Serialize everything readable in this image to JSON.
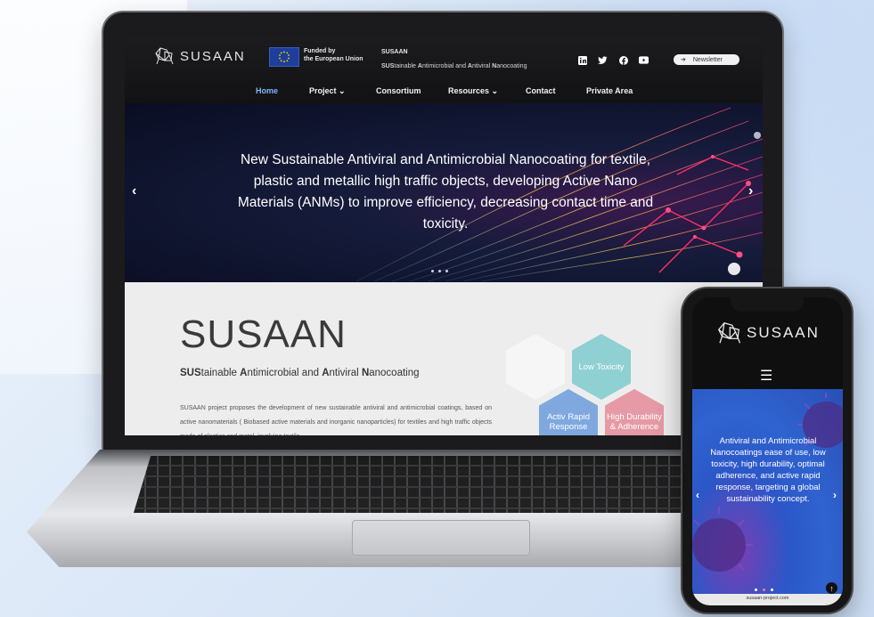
{
  "site": {
    "logo_text": "SUSAAN",
    "eu": {
      "line1": "Funded by",
      "line2": "the European Union"
    },
    "project_short": "SUSAAN",
    "project_full_prefix": "SUS",
    "project_full_rest": "tainable ",
    "project_full_a": "A",
    "project_full_mid": "ntimicrobial and ",
    "project_full_a2": "A",
    "project_full_mid2": "ntiviral ",
    "project_full_n": "N",
    "project_full_end": "anocoating",
    "social_icons": [
      "linkedin-icon",
      "twitter-icon",
      "facebook-icon",
      "youtube-icon"
    ],
    "newsletter_label": "Newsletter",
    "nav": [
      {
        "label": "Home",
        "active": true
      },
      {
        "label": "Project ⌄"
      },
      {
        "label": "Consortium"
      },
      {
        "label": "Resources ⌄"
      },
      {
        "label": "Contact"
      },
      {
        "label": "Private Area"
      }
    ]
  },
  "hero": {
    "text": "New Sustainable Antiviral and Antimicrobial Nanocoating for textile, plastic and metallic high traffic objects, developing Active Nano Materials (ANMs) to improve efficiency, decreasing contact time and toxicity.",
    "prev": "‹",
    "next": "›"
  },
  "intro": {
    "title": "SUSAAN",
    "sub_sus": "SUS",
    "sub_1": "tainable ",
    "sub_a": "A",
    "sub_2": "ntimicrobial and ",
    "sub_a2": "A",
    "sub_3": "ntiviral ",
    "sub_n": "N",
    "sub_4": "anocoating",
    "body": "SUSAAN project proposes the development of new sustainable antiviral and antimicrobial coatings, based on active nanomaterials ( Biobased active materials and inorganic nanoparticles) for textiles and high traffic objects made of plastics and metal, involving textile,"
  },
  "hexagons": [
    {
      "label": "",
      "color": "#f4f4f4"
    },
    {
      "label": "Low Toxicity",
      "color": "#8fd0d2"
    },
    {
      "label": "Activ Rapid Response",
      "color": "#7fa8df"
    },
    {
      "label": "High Durability & Adherence",
      "color": "#e59aa5"
    }
  ],
  "phone": {
    "logo_text": "SUSAAN",
    "menu_icon": "☰",
    "hero_text": "Antiviral and Antimicrobial Nanocoatings ease of use, low toxicity, high durability, optimal adherence, and active rapid response, targeting a global sustainability concept.",
    "prev": "‹",
    "next": "›",
    "up": "↑",
    "footer": "susaan-project.com"
  }
}
